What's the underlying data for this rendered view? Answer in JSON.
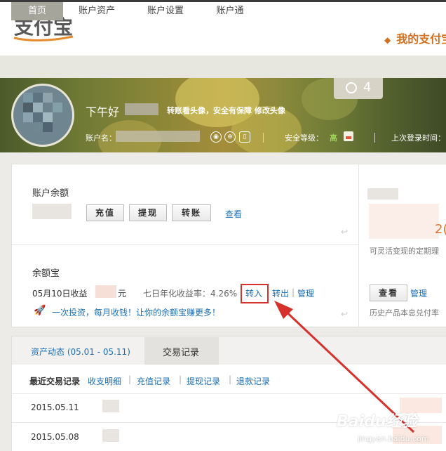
{
  "brand": {
    "logo_text": "支付宝",
    "header_link": "我的支付宝"
  },
  "nav": {
    "items": [
      {
        "label": "首页"
      },
      {
        "label": "账户资产"
      },
      {
        "label": "账户设置"
      },
      {
        "label": "账户通"
      }
    ]
  },
  "banner": {
    "alarm_count": "4",
    "greeting": "下午好",
    "avatar_tip": "转账看头像，安全有保障",
    "change_avatar": "修改头像",
    "account_label": "账户名：",
    "security_label": "安全等级：",
    "security_value": "高",
    "last_login_label": "上次登录时间："
  },
  "balance": {
    "title": "账户余额",
    "recharge": "充值",
    "withdraw": "提现",
    "transfer": "转账",
    "view": "查看"
  },
  "yuebao": {
    "title": "余额宝",
    "income_prefix": "05月10日收益",
    "income_suffix": "元",
    "rate_text": "七日年化收益率：4.26%",
    "transfer_in": "转入",
    "transfer_out": "转出",
    "manage": "管理",
    "promo": "一次投资，每月收钱！让你的余额宝赚更多！"
  },
  "right_panel": {
    "partial_value": "2(",
    "desc": "可灵活变现的定期理",
    "view_button": "查看",
    "manage": "管理",
    "history": "历史产品本息兑付率"
  },
  "records": {
    "tab_asset": "资产动态",
    "tab_asset_range": "(05.01 - 05.11)",
    "tab_trade": "交易记录",
    "recent_label": "最近交易记录",
    "filters": [
      "收支明细",
      "充值记录",
      "提现记录",
      "退款记录"
    ],
    "rows": [
      {
        "date": "2015.05.11"
      },
      {
        "date": "2015.05.08"
      }
    ]
  },
  "watermark": {
    "text": "Baidu经验",
    "url": "jingyan.baidu.com"
  },
  "colors": {
    "accent_orange": "#d46f1f",
    "link_blue": "#1c6fb6",
    "highlight_red": "#d7312c",
    "nav_active": "#a6a59b"
  }
}
